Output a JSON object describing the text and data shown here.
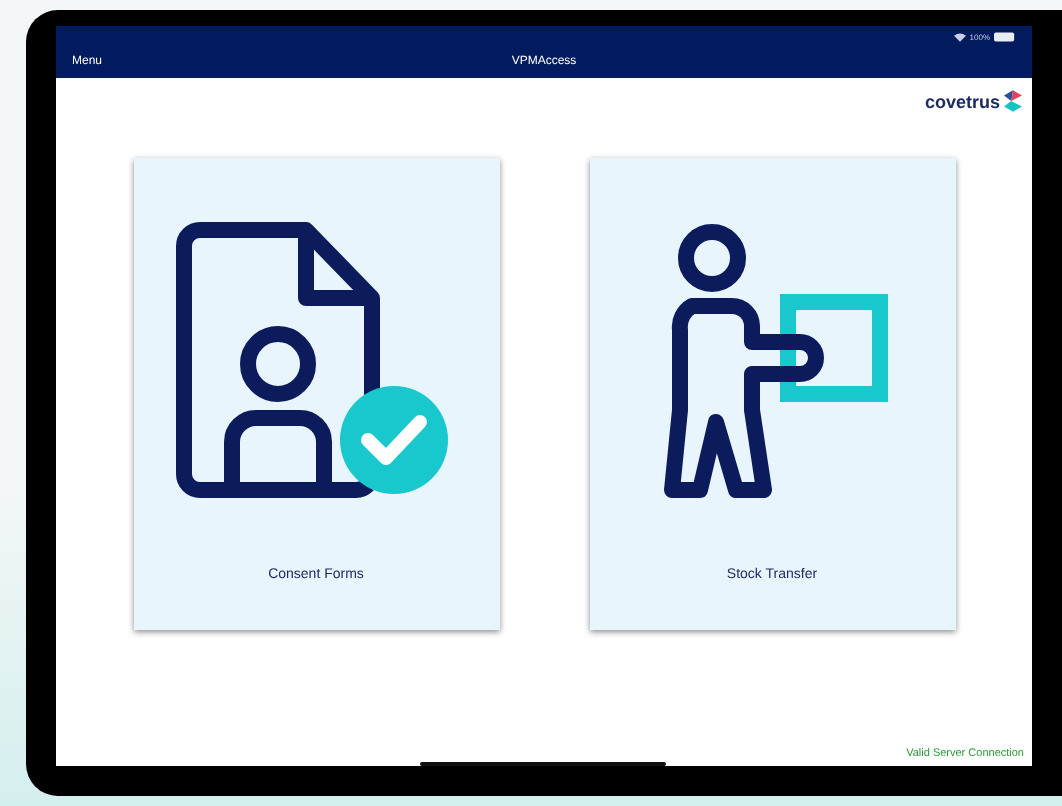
{
  "status_bar": {
    "battery": "100%"
  },
  "nav_bar": {
    "left": "Menu",
    "title": "VPMAccess"
  },
  "logo": {
    "text": "covetrus"
  },
  "tiles": [
    {
      "kind": "consent",
      "label": "Consent Forms"
    },
    {
      "kind": "stock",
      "label": "Stock Transfer"
    }
  ],
  "footer": {
    "status": "Valid Server Connection"
  }
}
